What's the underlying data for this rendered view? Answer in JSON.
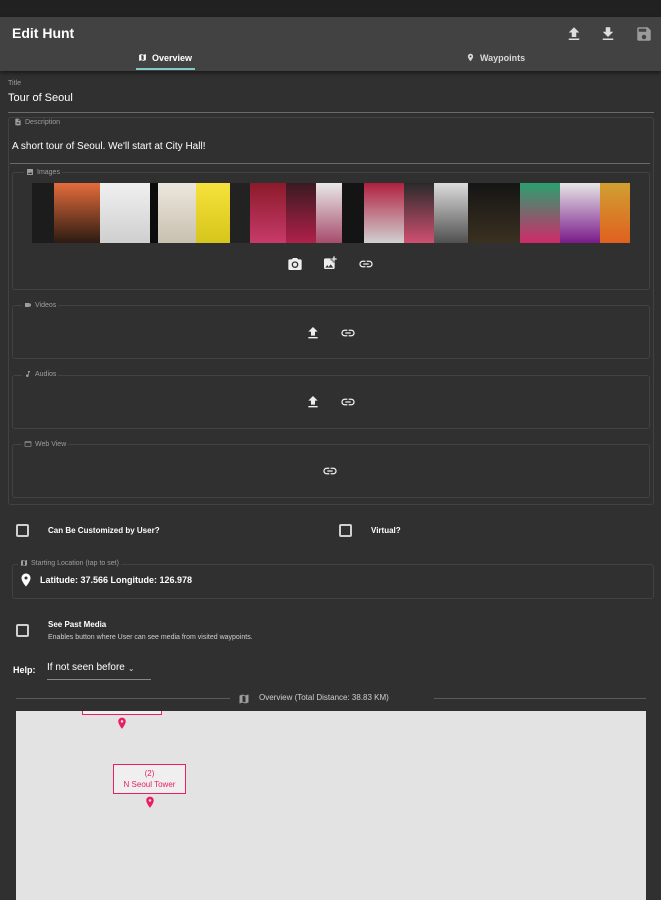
{
  "app": {
    "title": "Edit Hunt",
    "actions": [
      "upload-icon",
      "download-icon",
      "save-icon"
    ]
  },
  "tabs": [
    {
      "label": "Overview",
      "icon": "map-icon",
      "active": true
    },
    {
      "label": "Waypoints",
      "icon": "location-pin-icon",
      "active": false
    }
  ],
  "form": {
    "title_label": "Title",
    "title_value": "Tour of Seoul",
    "description_label": "Description",
    "description_value": "A short tour of Seoul.  We'll start at City Hall!",
    "images_label": "Images",
    "videos_label": "Videos",
    "audios_label": "Audios",
    "webview_label": "Web View",
    "customized_label": "Can Be Customized by User?",
    "customized_checked": false,
    "virtual_label": "Virtual?",
    "virtual_checked": false,
    "starting_location_label": "Starting Location (tap to set)",
    "starting_location_value": "Latitude: 37.566 Longitude: 126.978",
    "see_past_media_label": "See Past Media",
    "see_past_media_sub": "Enables button where User can see media from visited waypoints.",
    "see_past_media_checked": false,
    "help_label": "Help:",
    "help_value": "If not seen before"
  },
  "overview": {
    "title": "Overview (Total Distance: 38.83 KM)",
    "markers": [
      {
        "label": ""
      },
      {
        "label_num": "(2)",
        "label_name": "N Seoul Tower"
      }
    ]
  },
  "colors": {
    "background": "#303030",
    "appbar": "#424242",
    "accent": "#80cbc4",
    "marker": "#e91e63"
  }
}
